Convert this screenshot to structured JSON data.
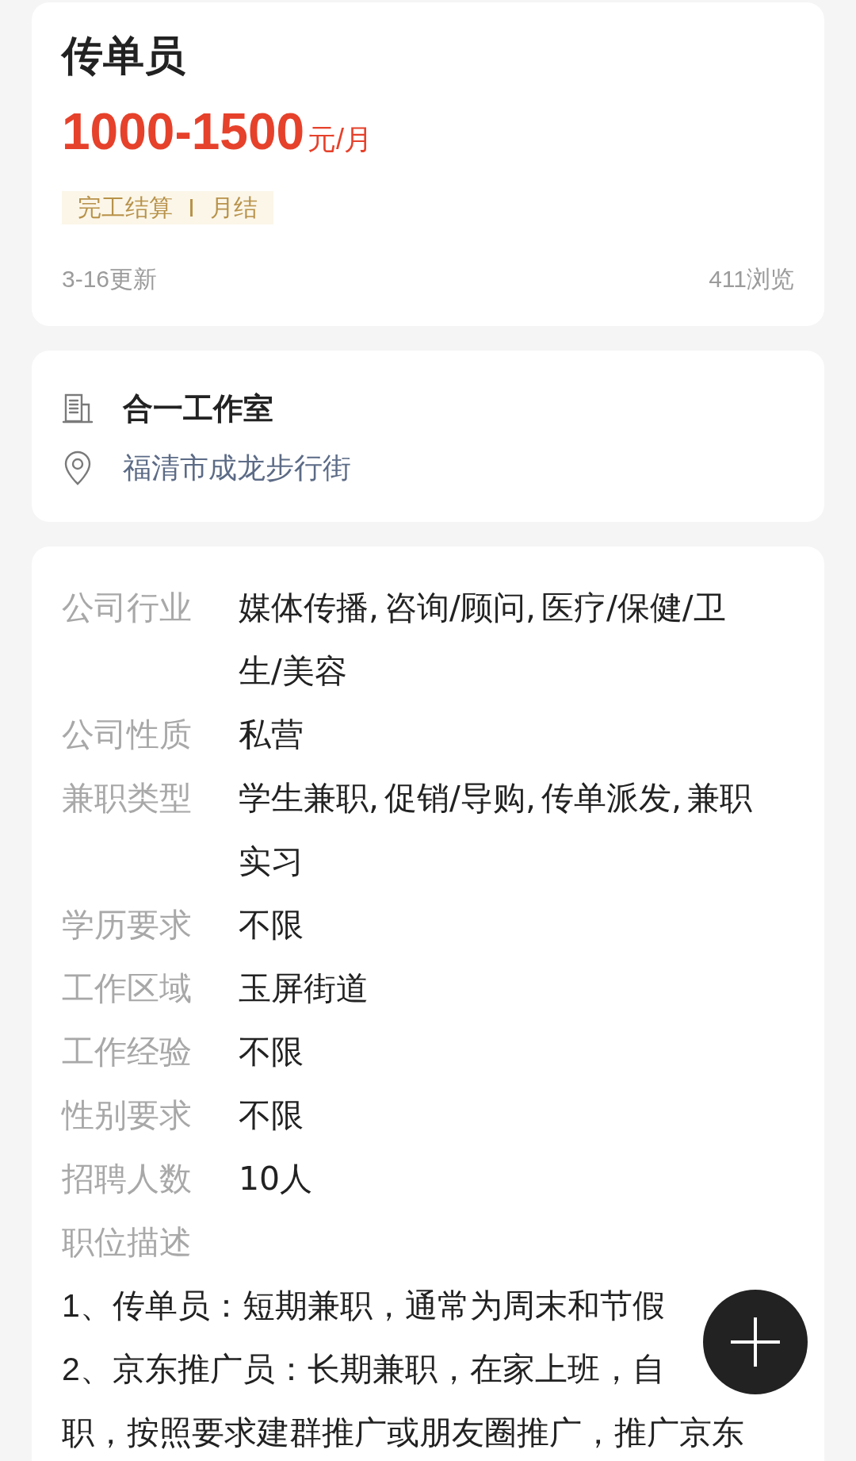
{
  "job": {
    "title": "传单员",
    "salary": {
      "amount": "1000-1500",
      "unit": "元/月"
    },
    "tags": [
      "完工结算",
      "月结"
    ],
    "updated": "3-16更新",
    "views": "411浏览"
  },
  "company": {
    "name": "合一工作室",
    "address": "福清市成龙步行街"
  },
  "details": [
    {
      "label": "公司行业",
      "value": "媒体传播, 咨询/顾问, 医疗/保健/卫生/美容"
    },
    {
      "label": "公司性质",
      "value": "私营"
    },
    {
      "label": "兼职类型",
      "value": "学生兼职, 促销/导购, 传单派发, 兼职实习"
    },
    {
      "label": "学历要求",
      "value": "不限"
    },
    {
      "label": "工作区域",
      "value": "玉屏街道"
    },
    {
      "label": "工作经验",
      "value": "不限"
    },
    {
      "label": "性别要求",
      "value": "不限"
    },
    {
      "label": "招聘人数",
      "value": "10人"
    }
  ],
  "description": {
    "label": "职位描述",
    "lines": [
      "1、传单员：短期兼职，通常为周末和节假",
      "2、京东推广员：长期兼职，在家上班，自",
      "职，按照要求建群推广或朋友圈推广，推广京东"
    ]
  }
}
